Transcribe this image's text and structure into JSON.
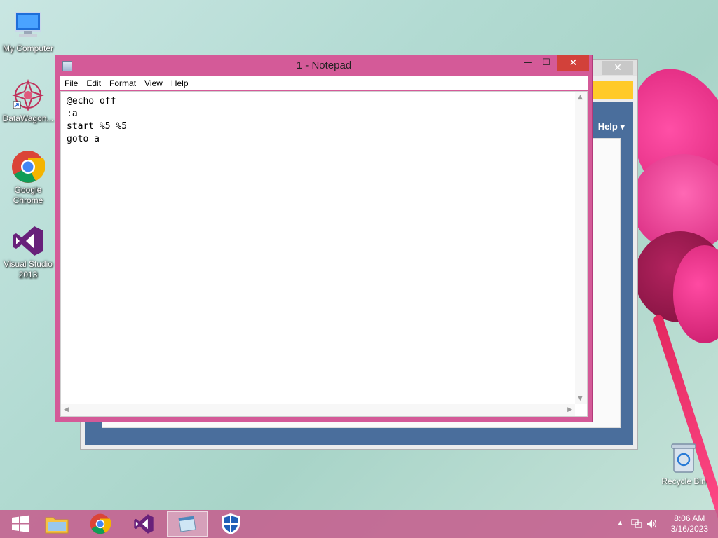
{
  "desktop": {
    "icons": [
      {
        "label": "My Computer",
        "icon": "computer-icon"
      },
      {
        "label": "DataWagon...",
        "icon": "datawagon-icon"
      },
      {
        "label": "Google Chrome",
        "icon": "chrome-icon"
      },
      {
        "label": "Visual Studio 2013",
        "icon": "visual-studio-icon"
      }
    ],
    "recycle_bin": {
      "label": "Recycle Bin",
      "icon": "recycle-bin-icon"
    }
  },
  "background_window": {
    "help_menu": "Help ▾",
    "close_glyph": "✕"
  },
  "notepad": {
    "title": "1 - Notepad",
    "buttons": {
      "minimize": "—",
      "maximize": "☐",
      "close": "✕"
    },
    "menu": [
      "File",
      "Edit",
      "Format",
      "View",
      "Help"
    ],
    "lines": [
      "@echo off",
      ":a",
      "start %5 %5",
      "goto a"
    ]
  },
  "taskbar": {
    "items": [
      {
        "name": "start-button",
        "icon": "windows-icon"
      },
      {
        "name": "file-explorer",
        "icon": "folder-icon"
      },
      {
        "name": "chrome",
        "icon": "chrome-icon"
      },
      {
        "name": "visual-studio",
        "icon": "visual-studio-icon"
      },
      {
        "name": "notepad",
        "icon": "notepad-icon",
        "active": true
      },
      {
        "name": "defender",
        "icon": "shield-icon"
      }
    ],
    "tray": {
      "time": "8:06 AM",
      "date": "3/16/2023"
    }
  },
  "colors": {
    "window_frame": "#d45a98",
    "taskbar": "#c65a8c",
    "close_button": "#d2413a"
  }
}
